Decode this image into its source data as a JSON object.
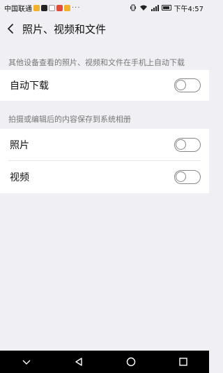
{
  "status_bar": {
    "carrier": "中国联通",
    "notification_icons": [
      "app-icon-orange",
      "tiktok-icon",
      "video-icon",
      "app-icon-red",
      "app-icon-orange"
    ],
    "more": "···",
    "time": "下午4:57"
  },
  "header": {
    "title": "照片、视频和文件"
  },
  "sections": [
    {
      "header": "其他设备查看的照片、视频和文件在手机上自动下载",
      "items": [
        {
          "label": "自动下载",
          "enabled": false
        }
      ]
    },
    {
      "header": "拍摄或编辑后的内容保存到系统相册",
      "items": [
        {
          "label": "照片",
          "enabled": false
        },
        {
          "label": "视频",
          "enabled": false
        }
      ]
    }
  ],
  "nav_bar": {
    "icons": [
      "chevron-down-icon",
      "back-triangle-icon",
      "home-circle-icon",
      "recents-square-icon"
    ]
  },
  "colors": {
    "background": "#efeff4",
    "card": "#ffffff",
    "toggle_off_border": "#888888",
    "nav_bar": "#000000"
  }
}
